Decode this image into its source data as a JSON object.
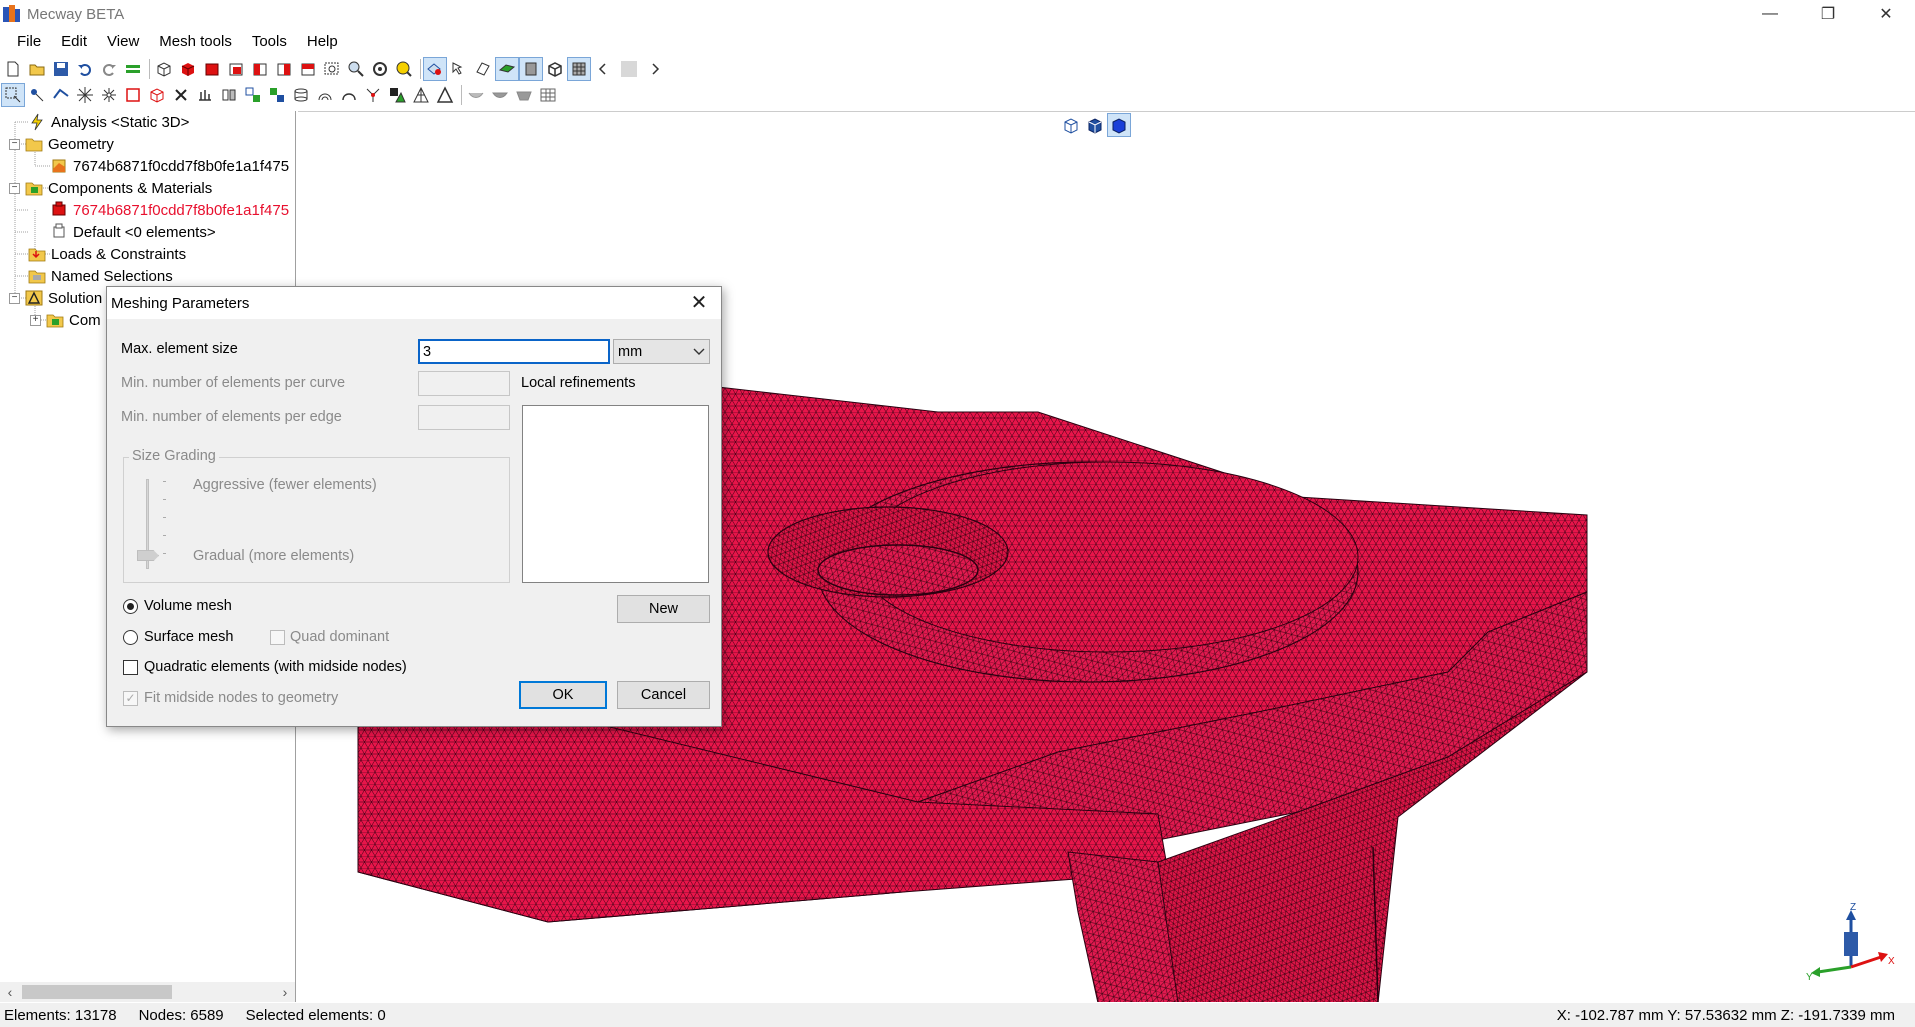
{
  "window": {
    "title": "Mecway BETA",
    "minimize_glyph": "—",
    "restore_glyph": "❐",
    "close_glyph": "✕"
  },
  "menu": {
    "items": [
      "File",
      "Edit",
      "View",
      "Mesh tools",
      "Tools",
      "Help"
    ]
  },
  "tree": {
    "analysis": "Analysis <Static 3D>",
    "geometry": "Geometry",
    "geometry_item": "7674b6871f0cdd7f8b0fe1a1f475",
    "components": "Components & Materials",
    "component_item": "7674b6871f0cdd7f8b0fe1a1f475",
    "default_item": "Default <0 elements>",
    "loads": "Loads & Constraints",
    "named_selections": "Named Selections",
    "solution": "Solution",
    "solution_child": "Com",
    "highlight_color": "#e8102e"
  },
  "statusbar": {
    "elements": "Elements: 13178",
    "nodes": "Nodes: 6589",
    "selected": "Selected elements: 0",
    "coords": "X: -102.787 mm Y: 57.53632 mm Z: -191.7339 mm"
  },
  "dialog": {
    "title": "Meshing Parameters",
    "close_glyph": "✕",
    "max_size_label": "Max. element size",
    "max_size_value": "3",
    "unit": "mm",
    "min_curve_label": "Min. number of elements per curve",
    "min_edge_label": "Min. number of elements per edge",
    "local_refinements_label": "Local refinements",
    "size_grading_label": "Size Grading",
    "aggressive_label": "Aggressive (fewer elements)",
    "gradual_label": "Gradual (more elements)",
    "volume_mesh_label": "Volume mesh",
    "surface_mesh_label": "Surface mesh",
    "quad_dominant_label": "Quad dominant",
    "quadratic_label": "Quadratic elements (with midside nodes)",
    "fit_midside_label": "Fit midside nodes to geometry",
    "new_button": "New",
    "ok_button": "OK",
    "cancel_button": "Cancel",
    "checkmark": "✓",
    "volume_mesh_selected": true,
    "quadratic_checked": false,
    "fit_midside_checked": true,
    "grading_level": 0.9
  },
  "viewport": {
    "mesh_color": "#e8154a",
    "mesh_line_color": "#1a0008",
    "axis_labels": {
      "z": "Z",
      "y": "Y",
      "x": "X"
    }
  },
  "icons": {
    "toolbar1": [
      "new-file-icon",
      "open-folder-icon",
      "save-icon",
      "undo-icon",
      "redo-icon",
      "layers-icon",
      "wireframe-cube-icon",
      "solid-cube-icon",
      "front-view-icon",
      "back-view-icon",
      "left-view-icon",
      "right-view-icon",
      "top-view-icon",
      "zoom-box-icon",
      "zoom-icon",
      "rotate-icon",
      "pan-icon",
      "select-tool-icon",
      "select-mode-icon",
      "clip-plane-icon",
      "surface-icon",
      "shaded-icon",
      "edges-icon",
      "mesh-icon",
      "scroll-left-icon",
      "color-swatch-icon",
      "scroll-right-icon"
    ],
    "toolbar2": [
      "select-box-icon",
      "select-node-icon",
      "select-edge-icon",
      "explode-icon",
      "star-icon",
      "rectangle-icon",
      "cube-outline-icon",
      "delete-icon",
      "extrude-icon",
      "mirror-icon",
      "split-icon",
      "merge-icon",
      "cylinder-icon",
      "revolve-icon",
      "sweep-icon",
      "refine-icon",
      "triangle-solid-icon",
      "triangle-mesh-icon",
      "triangle-outline-icon",
      "shell-icon",
      "shell2-icon",
      "shell3-icon",
      "table-icon"
    ]
  }
}
